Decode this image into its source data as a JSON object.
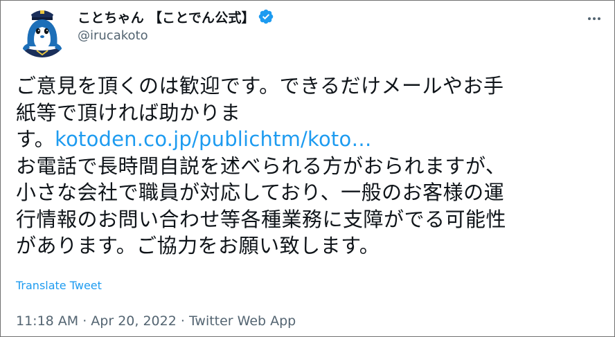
{
  "author": {
    "display_name": "ことちゃん 【ことでん公式】",
    "handle": "@irucakoto",
    "verified_icon": "verified-badge-icon",
    "avatar_icon": "dolphin-mascot-avatar"
  },
  "menu": {
    "more_icon": "more-options-icon"
  },
  "tweet": {
    "line1": "ご意見を頂くのは歓迎です。できるだけメールやお手",
    "line2": "紙等で頂ければ助かりま",
    "line3_prefix": "す。",
    "link_text": "kotoden.co.jp/publichtm/koto…",
    "line4": "お電話で長時間自説を述べられる方がおられますが、",
    "line5": "小さな会社で職員が対応しており、一般のお客様の運",
    "line6": "行情報のお問い合わせ等各種業務に支障がでる可能性",
    "line7": "があります。ご協力をお願い致します。"
  },
  "translate_label": "Translate Tweet",
  "meta": {
    "timestamp": "11:18 AM · Apr 20, 2022 · Twitter Web App"
  },
  "colors": {
    "link": "#1d9bf0",
    "secondary_text": "#536471",
    "primary_text": "#0f1419",
    "avatar_blue": "#1d6fb8"
  }
}
